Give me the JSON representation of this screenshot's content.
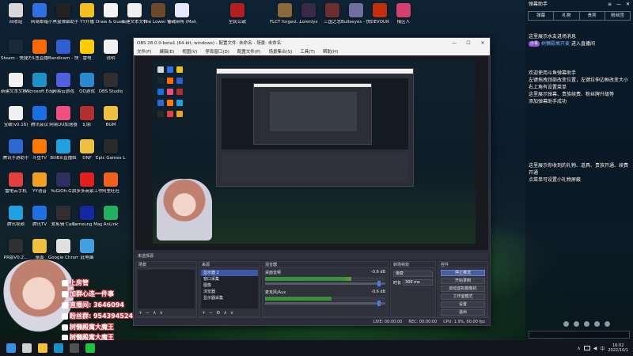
{
  "desktop_icons": [
    {
      "label": "回收站",
      "color": "#d8d8d8"
    },
    {
      "label": "网易邮箱",
      "color": "#2f6fe0"
    },
    {
      "label": "小黑盒弹幕助手",
      "color": "#222222"
    },
    {
      "label": "YY开播",
      "color": "#f0c020"
    },
    {
      "label": "Draw & Guess",
      "color": "#f4f4f4"
    },
    {
      "label": "新建文本文档",
      "color": "#f0f0f0"
    },
    {
      "label": "The Lower West - On...",
      "color": "#6a4a2a"
    },
    {
      "label": "雀魂麻将 (Mahjong...",
      "color": "#e6e6ff"
    },
    {
      "label": "全民公敌",
      "color": "#b02020"
    },
    {
      "label": "FLCT forged...",
      "color": "#8a6a3a"
    },
    {
      "label": "Lorenlys",
      "color": "#3a2a4a"
    },
    {
      "label": "三国之志",
      "color": "#6a3030"
    },
    {
      "label": "Bullseyes - 快捷方式",
      "color": "#7070a0"
    },
    {
      "label": "DEVOUR",
      "color": "#c03010"
    },
    {
      "label": "俄区人",
      "color": "#d04070"
    },
    {
      "label": "Steam - 快捷方式",
      "color": "#1b2838"
    },
    {
      "label": "斗鱼直播",
      "color": "#ff6a00"
    },
    {
      "label": "Bandicam - 快捷方式",
      "color": "#3060d0"
    },
    {
      "label": "雷电",
      "color": "#ffcc00"
    },
    {
      "label": "说明",
      "color": "#f0f0f0"
    },
    {
      "label": "新建文本文档 (2)",
      "color": "#f0f0f0"
    },
    {
      "label": "Microsoft Edge",
      "color": "#1e90c8"
    },
    {
      "label": "网易云游戏",
      "color": "#5060e0"
    },
    {
      "label": "QQ游戏",
      "color": "#2a8ad0"
    },
    {
      "label": "OBS Studio",
      "color": "#302e31"
    },
    {
      "label": "宝破(v0.16)",
      "color": "#f0f0f0"
    },
    {
      "label": "腾讯会议",
      "color": "#1a6fe0"
    },
    {
      "label": "网易UU加速器",
      "color": "#f05080"
    },
    {
      "label": "幻影",
      "color": "#b03030"
    },
    {
      "label": "BGM",
      "color": "#f0c040"
    },
    {
      "label": "腾讯手游助手",
      "color": "#2a6ad0"
    },
    {
      "label": "斗鱼TV",
      "color": "#ff7a00"
    },
    {
      "label": "BiliBili直播姬",
      "color": "#20a0e0"
    },
    {
      "label": "DNF",
      "color": "#f0c040"
    },
    {
      "label": "Epic Games Launcher",
      "color": "#2a2a2a"
    },
    {
      "label": "雷电云手机",
      "color": "#e04040"
    },
    {
      "label": "YY语音",
      "color": "#f0a020"
    },
    {
      "label": "YuGiOh-G...",
      "color": "#303060"
    },
    {
      "label": "拼多多商家工作台",
      "color": "#e02020"
    },
    {
      "label": "阿里旺旺",
      "color": "#f06020"
    },
    {
      "label": "腾讯视频",
      "color": "#20a0e0"
    },
    {
      "label": "腾讯TV",
      "color": "#2070e0"
    },
    {
      "label": "爱剪辑 Cast",
      "color": "#303030"
    },
    {
      "label": "Samsung Magician",
      "color": "#1428a0"
    },
    {
      "label": "AnLink",
      "color": "#20b060"
    },
    {
      "label": "PR版V0.2...",
      "color": "#303030"
    },
    {
      "label": "桌面",
      "color": "#f0c040"
    },
    {
      "label": "Google Chrome",
      "color": "#e0e0e0"
    },
    {
      "label": "此电脑",
      "color": "#40a0e0"
    }
  ],
  "obs": {
    "title": "OBS 28.0.0-beta1 (64-bit, windows) - 配置文件: 未命名 - 场景: 未命名",
    "window_controls": [
      "—",
      "☐",
      "✕"
    ],
    "menu": [
      "文件(F)",
      "编辑(E)",
      "视图(V)",
      "停靠窗口(D)",
      "配置文件(P)",
      "场景集合(S)",
      "工具(T)",
      "帮助(H)"
    ],
    "scene_bar_label": "未选择源",
    "docks": {
      "scenes": {
        "title": "场景",
        "items": []
      },
      "sources": {
        "title": "来源",
        "items": [
          "显示器 2",
          "窗口采集",
          "图像",
          "浏览器",
          "显示器采集"
        ]
      },
      "mixer": {
        "title": "混音器",
        "channels": [
          {
            "name": "桌面音频",
            "db": "-0.6 dB",
            "level": 0.72
          },
          {
            "name": "麦克风/Aux",
            "db": "-0.6 dB",
            "level": 0.55
          }
        ]
      },
      "transitions": {
        "title": "转场特效",
        "type": "渐变",
        "duration_label": "时长",
        "duration": "300 ms"
      },
      "controls": {
        "title": "控件",
        "buttons": [
          "停止推流",
          "开始录制",
          "启动虚拟摄像机",
          "工作室模式",
          "设置",
          "退出"
        ]
      }
    },
    "status": {
      "live": "LIVE: 00:00:00",
      "rec": "REC: 00:00:00",
      "cpu": "CPU: 1.9%, 60.00 fps"
    }
  },
  "danmaku": {
    "title": "弹幕助手",
    "tabs": [
      "弹幕",
      "礼物",
      "贵宾",
      "粉丝团"
    ],
    "messages": [
      {
        "type": "line",
        "text": "这里展示水友进场消息"
      },
      {
        "type": "msg",
        "badge": "小青",
        "user": "树懒殿寓开麦",
        "text": "进入直播间"
      },
      {
        "type": "line",
        "text": "欢迎使用斗鱼弹幕助手"
      },
      {
        "type": "line",
        "text": "左键拖拽顶部改变位置，左键拉伸边框改变大小"
      },
      {
        "type": "line",
        "text": "右上角有设置菜单"
      },
      {
        "type": "line",
        "text": "这里展示弹幕、贵族续费、粉丝牌升级等"
      },
      {
        "type": "line",
        "text": "添加弹幕助手成功"
      },
      {
        "type": "line",
        "text": "这里展示你收到的礼物、道具、贵族开通、续费开通"
      },
      {
        "type": "line",
        "text": "点菜单可设置小礼物屏蔽"
      }
    ]
  },
  "overlay": {
    "rows": [
      {
        "label": "上房管",
        "color": "#c0303a"
      },
      {
        "label": "加群心连一件事",
        "color": "#c0303a"
      },
      {
        "label": "直播间: 3646094",
        "color": "#c0303a"
      },
      {
        "label": "粉丝群: 954394524",
        "color": "#c0303a"
      },
      {
        "label": "树懒殿寓大魔王",
        "color": "#c0303a"
      },
      {
        "label": "树懒殿寓大魔王",
        "color": "#c0303a"
      }
    ]
  },
  "taskbar": {
    "apps": [
      {
        "name": "start-icon",
        "color": "#3a8ee0"
      },
      {
        "name": "search-icon",
        "color": "#d0d0d0"
      },
      {
        "name": "file-explorer-icon",
        "color": "#f0c040"
      },
      {
        "name": "edge-icon",
        "color": "#1e90c8"
      },
      {
        "name": "obs-icon",
        "color": "#505050"
      },
      {
        "name": "wechat-icon",
        "color": "#20c040"
      }
    ],
    "tray_icons": [
      "chevron-up-icon",
      "network-icon",
      "volume-icon",
      "ime-icon"
    ],
    "clock": {
      "time": "16:02",
      "date": "2022/10/1"
    }
  }
}
